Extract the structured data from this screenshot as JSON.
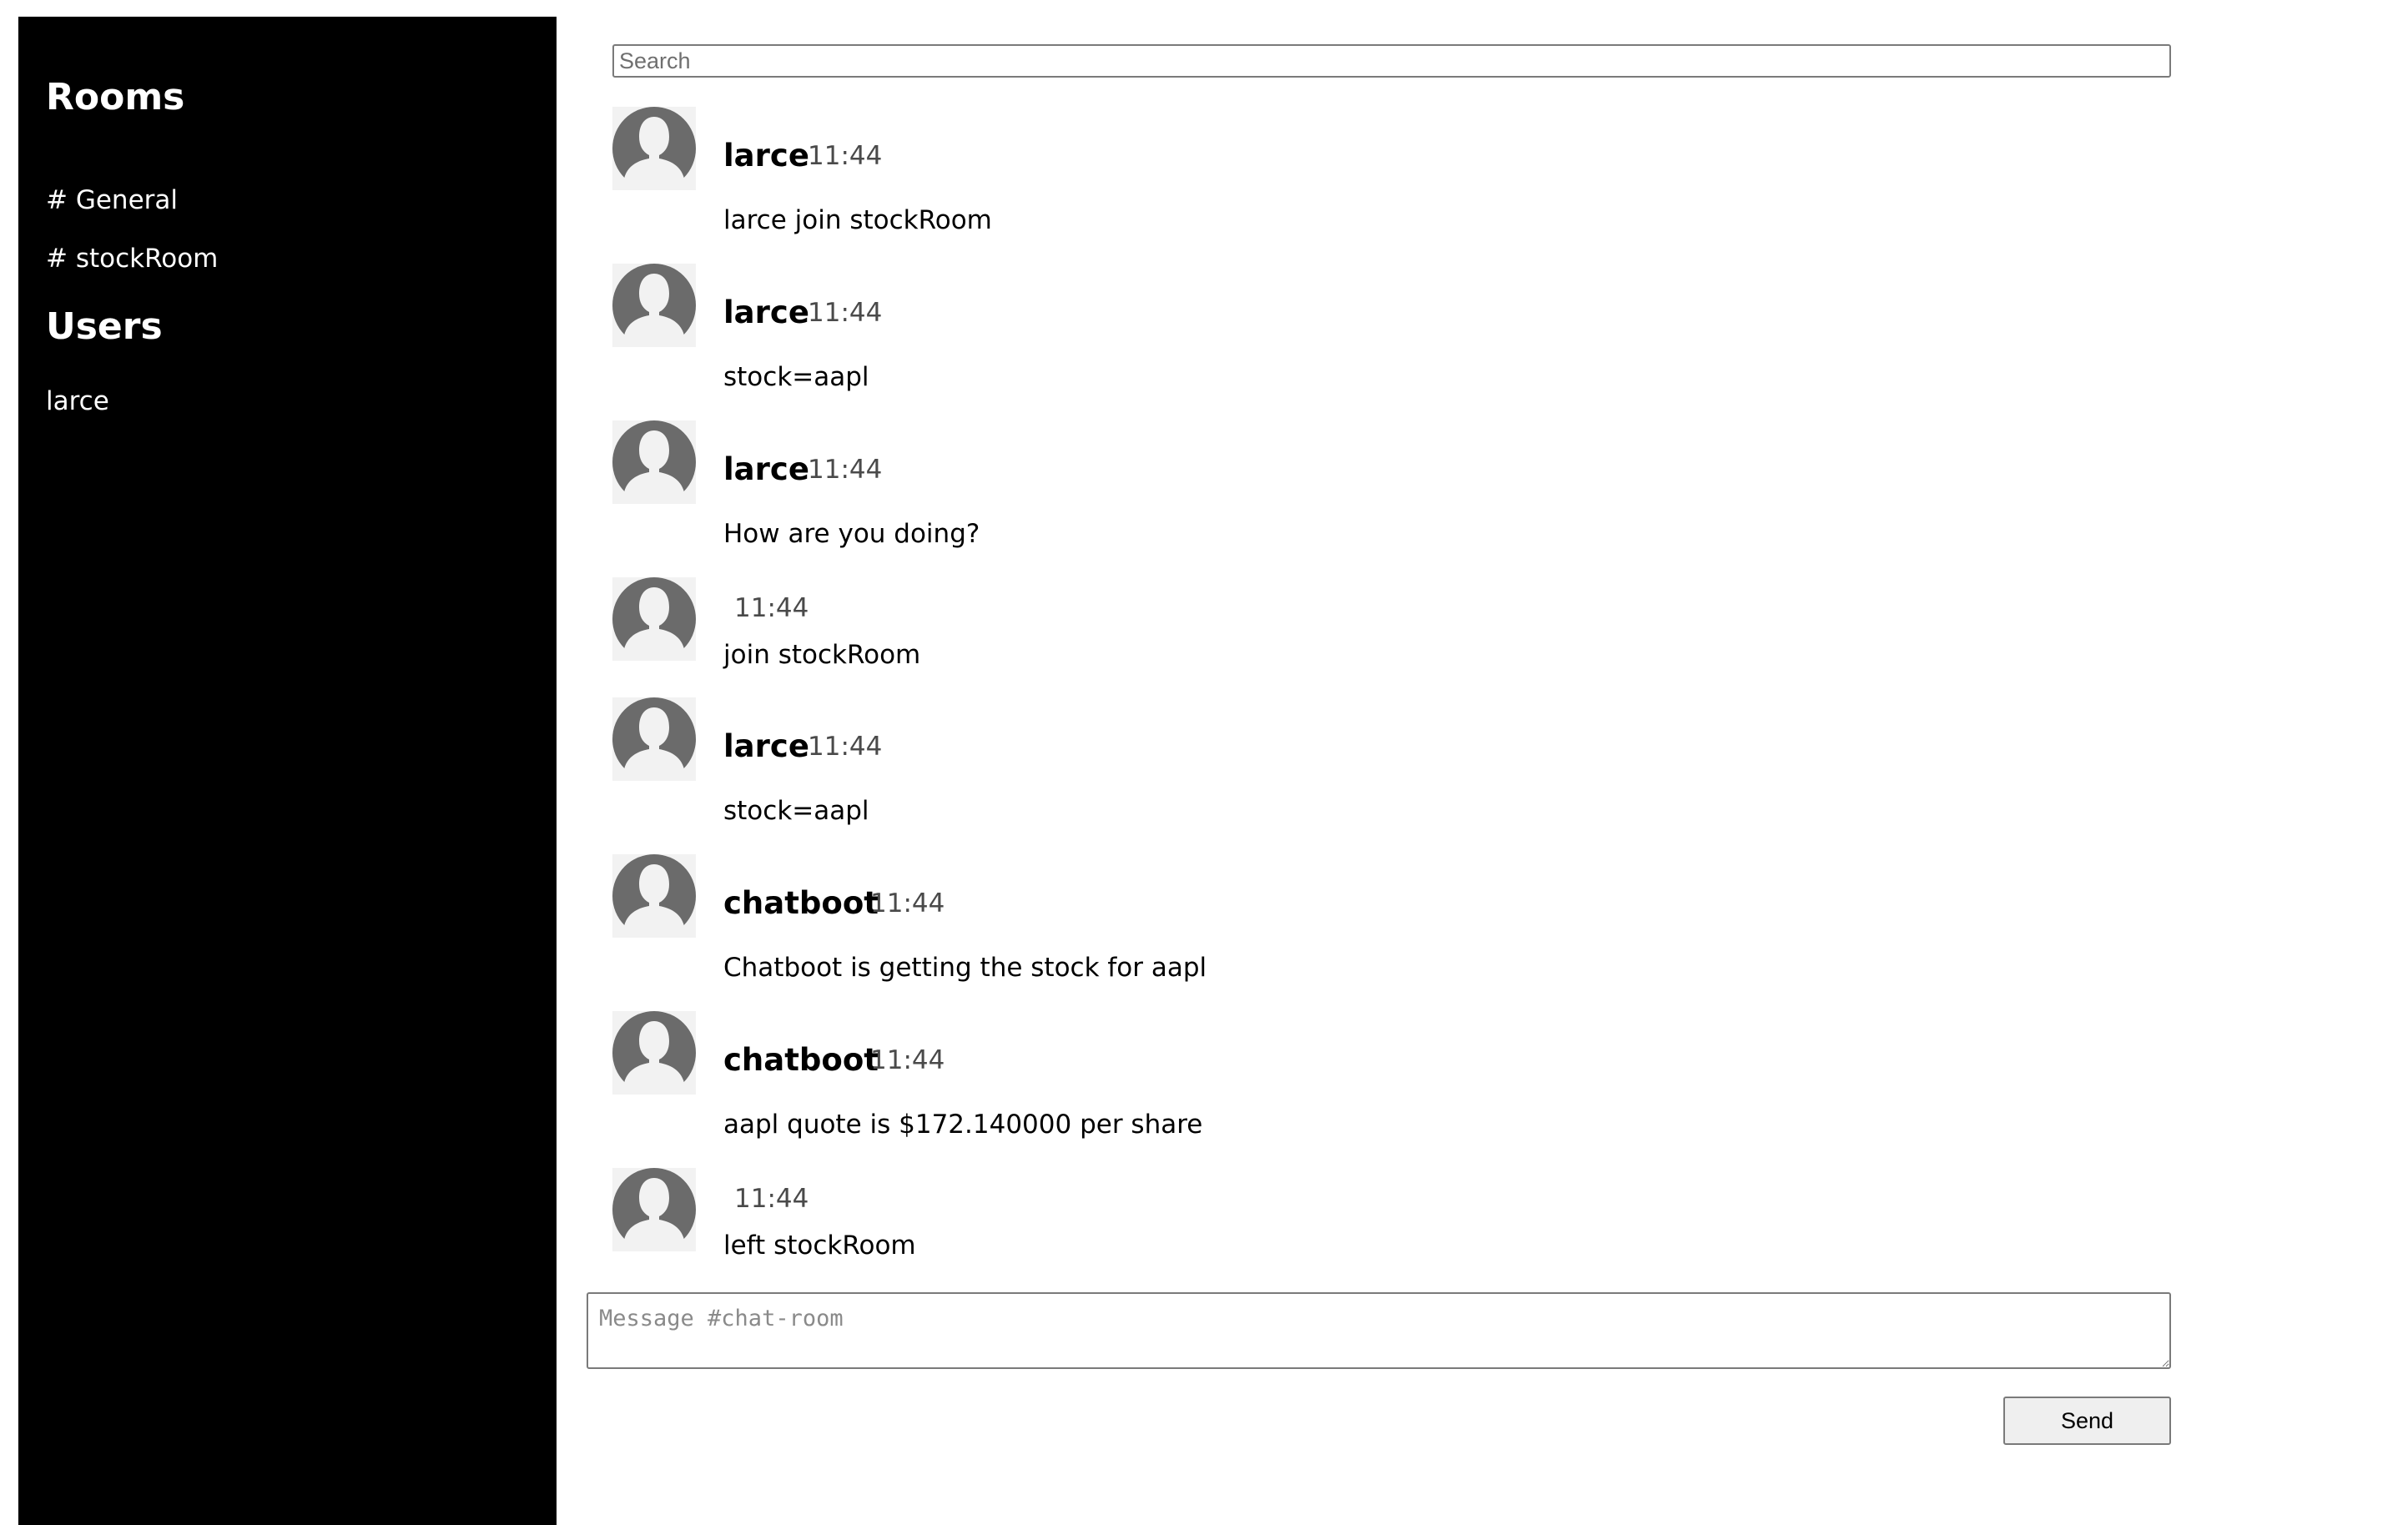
{
  "sidebar": {
    "rooms_heading": "Rooms",
    "rooms": [
      "# General",
      "# stockRoom"
    ],
    "users_heading": "Users",
    "users": [
      "larce"
    ]
  },
  "search": {
    "placeholder": "Search",
    "value": ""
  },
  "messages": [
    {
      "author": "larce",
      "time": "11:44",
      "text": "larce join stockRoom"
    },
    {
      "author": "larce",
      "time": "11:44",
      "text": "stock=aapl"
    },
    {
      "author": "larce",
      "time": "11:44",
      "text": "How are you doing?"
    },
    {
      "author": "",
      "time": "11:44",
      "text": "join stockRoom"
    },
    {
      "author": "larce",
      "time": "11:44",
      "text": "stock=aapl"
    },
    {
      "author": "chatboot",
      "time": "11:44",
      "text": "Chatboot is getting the stock for aapl"
    },
    {
      "author": "chatboot",
      "time": "11:44",
      "text": "aapl quote is $172.140000 per share"
    },
    {
      "author": "",
      "time": "11:44",
      "text": "left stockRoom"
    }
  ],
  "composer": {
    "placeholder": "Message #chat-room",
    "value": "",
    "send_label": "Send"
  },
  "colors": {
    "sidebar_background": "#000000",
    "sidebar_text": "#ffffff",
    "avatar_silhouette": "#6b6b6b",
    "avatar_background": "#f2f2f2"
  },
  "icons": {
    "avatar": "default-user-avatar-icon"
  }
}
